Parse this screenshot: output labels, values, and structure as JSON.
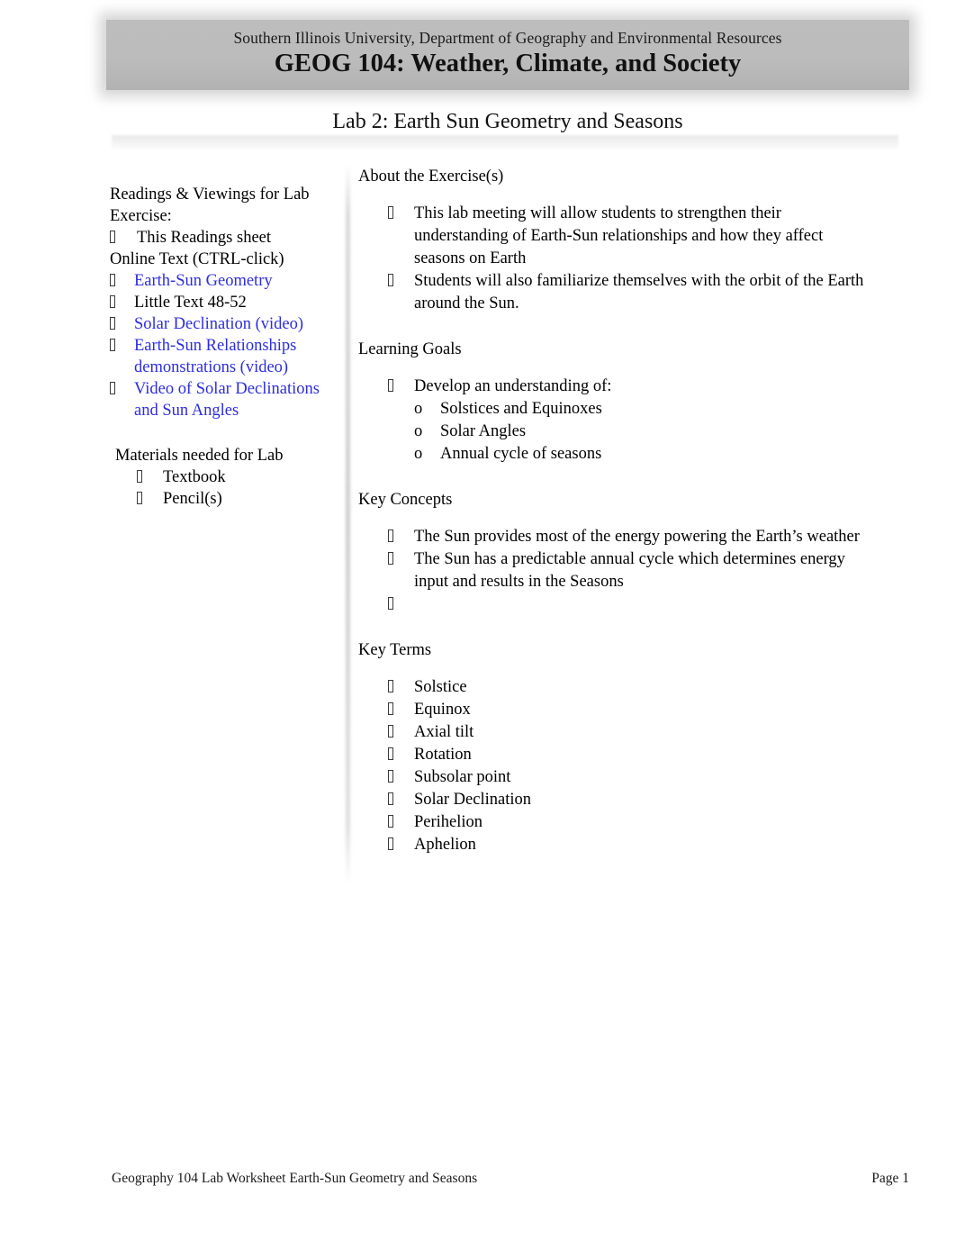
{
  "document": {
    "header": {
      "department_line": "Southern Illinois University, Department of Geography and Environmental Resources",
      "course_line": "GEOG 104: Weather, Climate, and Society"
    },
    "lab_title": "Lab 2: Earth Sun Geometry and Seasons"
  },
  "left_column": {
    "readings_heading": "Readings & Viewings for Lab Exercise:",
    "this_readings_sheet": "This Readings sheet",
    "online_text_label": "Online Text (CTRL-click)",
    "readings": [
      {
        "label": "Earth-Sun Geometry",
        "is_link": true
      },
      {
        "label": "Little Text 48-52",
        "is_link": false
      },
      {
        "label": "Solar Declination (video)",
        "is_link": true
      },
      {
        "label": "Earth-Sun Relationships demonstrations (video)",
        "is_link": true
      },
      {
        "label": "Video of Solar Declinations and Sun Angles",
        "is_link": true
      }
    ],
    "materials_heading": "Materials needed for Lab",
    "materials": [
      "Textbook",
      "Pencil(s)"
    ]
  },
  "right_column": {
    "about_heading": "About the Exercise(s)",
    "about_items": [
      "This lab meeting will allow students to strengthen their understanding of Earth-Sun relationships and how they affect seasons on Earth",
      "Students will also familiarize themselves with the orbit of the Earth around the Sun."
    ],
    "learning_goals_heading": "Learning Goals",
    "learning_goals_lead": "Develop an understanding of:",
    "learning_goals_sub": [
      "Solstices and Equinoxes",
      "Solar Angles",
      "Annual cycle of seasons"
    ],
    "key_concepts_heading": "Key Concepts",
    "key_concepts": [
      "The Sun provides most of the energy powering the Earth’s weather",
      "The Sun has a predictable annual cycle which determines energy input and results in the Seasons",
      ""
    ],
    "key_terms_heading": "Key Terms",
    "key_terms": [
      "Solstice",
      "Equinox",
      "Axial tilt",
      "Rotation",
      "Subsolar point",
      "Solar Declination",
      "Perihelion",
      "Aphelion"
    ]
  },
  "footer": {
    "left_text": "Geography 104 Lab Worksheet Earth-Sun Geometry and Seasons",
    "right_text": "Page 1"
  },
  "colors": {
    "banner_gray": "#bdbdbd",
    "link_blue": "#2d2de0",
    "text_black": "#111111"
  },
  "icons": {
    "bullet": "missing-glyph-box",
    "sub_bullet": "o"
  }
}
